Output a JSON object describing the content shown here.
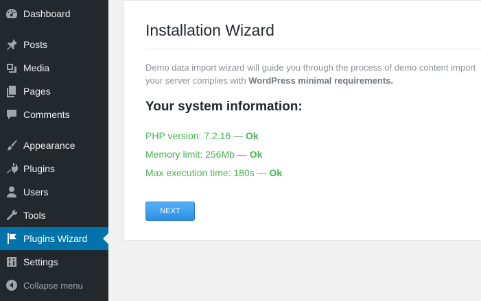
{
  "sidebar": {
    "items": [
      {
        "label": "Dashboard",
        "icon": "dashboard-icon"
      },
      {
        "label": "Posts",
        "icon": "pin-icon"
      },
      {
        "label": "Media",
        "icon": "media-icon"
      },
      {
        "label": "Pages",
        "icon": "pages-icon"
      },
      {
        "label": "Comments",
        "icon": "comment-icon"
      },
      {
        "label": "Appearance",
        "icon": "brush-icon"
      },
      {
        "label": "Plugins",
        "icon": "plug-icon"
      },
      {
        "label": "Users",
        "icon": "user-icon"
      },
      {
        "label": "Tools",
        "icon": "wrench-icon"
      },
      {
        "label": "Plugins Wizard",
        "icon": "flag-icon",
        "active": true
      },
      {
        "label": "Settings",
        "icon": "settings-icon"
      },
      {
        "label": "Collapse menu",
        "icon": "collapse-icon"
      }
    ],
    "active_color": "#0073aa"
  },
  "main": {
    "title": "Installation Wizard",
    "description_line1": "Demo data import wizard will guide you through the process of demo content import",
    "description_line2_prefix": "your server complies with ",
    "description_line2_bold": "WordPress minimal requirements.",
    "system_title": "Your system information:",
    "system": [
      {
        "text": "PHP version: 7.2.16 — ",
        "status": "Ok"
      },
      {
        "text": "Memory limit: 256Mb — ",
        "status": "Ok"
      },
      {
        "text": "Max execution time: 180s — ",
        "status": "Ok"
      }
    ],
    "ok_color": "#46b450",
    "next_label": "NEXT"
  }
}
